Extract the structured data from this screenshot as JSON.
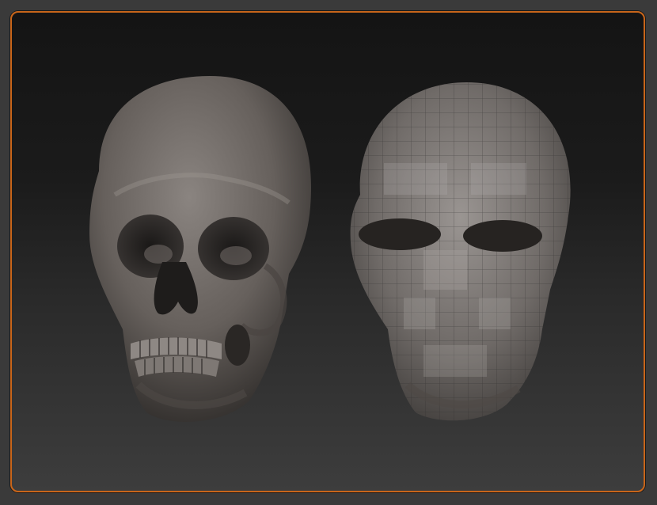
{
  "viewport": {
    "accent_color": "#c8651a",
    "background": "dark-gradient"
  },
  "models": [
    {
      "name": "sculpted-skull",
      "style": "high-detail smooth sculpt"
    },
    {
      "name": "lowpoly-skull",
      "style": "low-poly base mesh with visible grid"
    }
  ]
}
